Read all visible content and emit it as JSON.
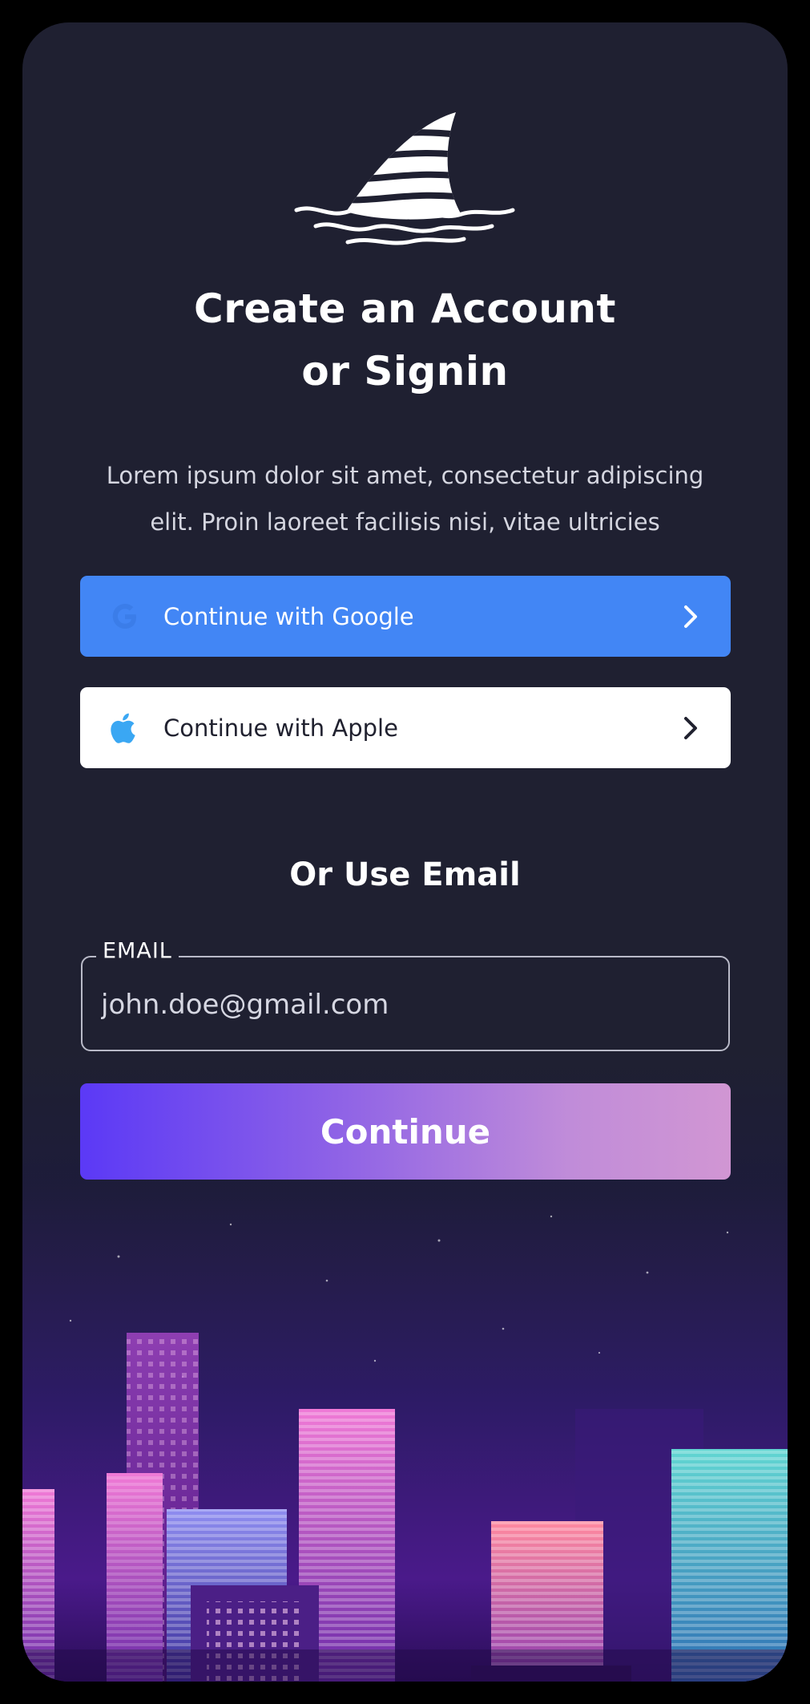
{
  "heading": {
    "line1": "Create an Account",
    "line2": "or Signin"
  },
  "subtitle": "Lorem ipsum dolor sit amet, consectetur adipiscing elit. Proin laoreet facilisis nisi, vitae ultricies",
  "social": {
    "google": {
      "label": "Continue with Google",
      "icon": "google-icon",
      "color": "#4286f5"
    },
    "apple": {
      "label": "Continue with Apple",
      "icon": "apple-icon",
      "icon_color": "#3aa7f3"
    }
  },
  "divider_text": "Or Use Email",
  "email": {
    "label": "EMAIL",
    "value": "john.doe@gmail.com"
  },
  "continue_label": "Continue",
  "colors": {
    "background": "#1f2031",
    "google_button": "#4286f5",
    "gradient_start": "#5b39f6",
    "gradient_end": "#d196d3"
  }
}
